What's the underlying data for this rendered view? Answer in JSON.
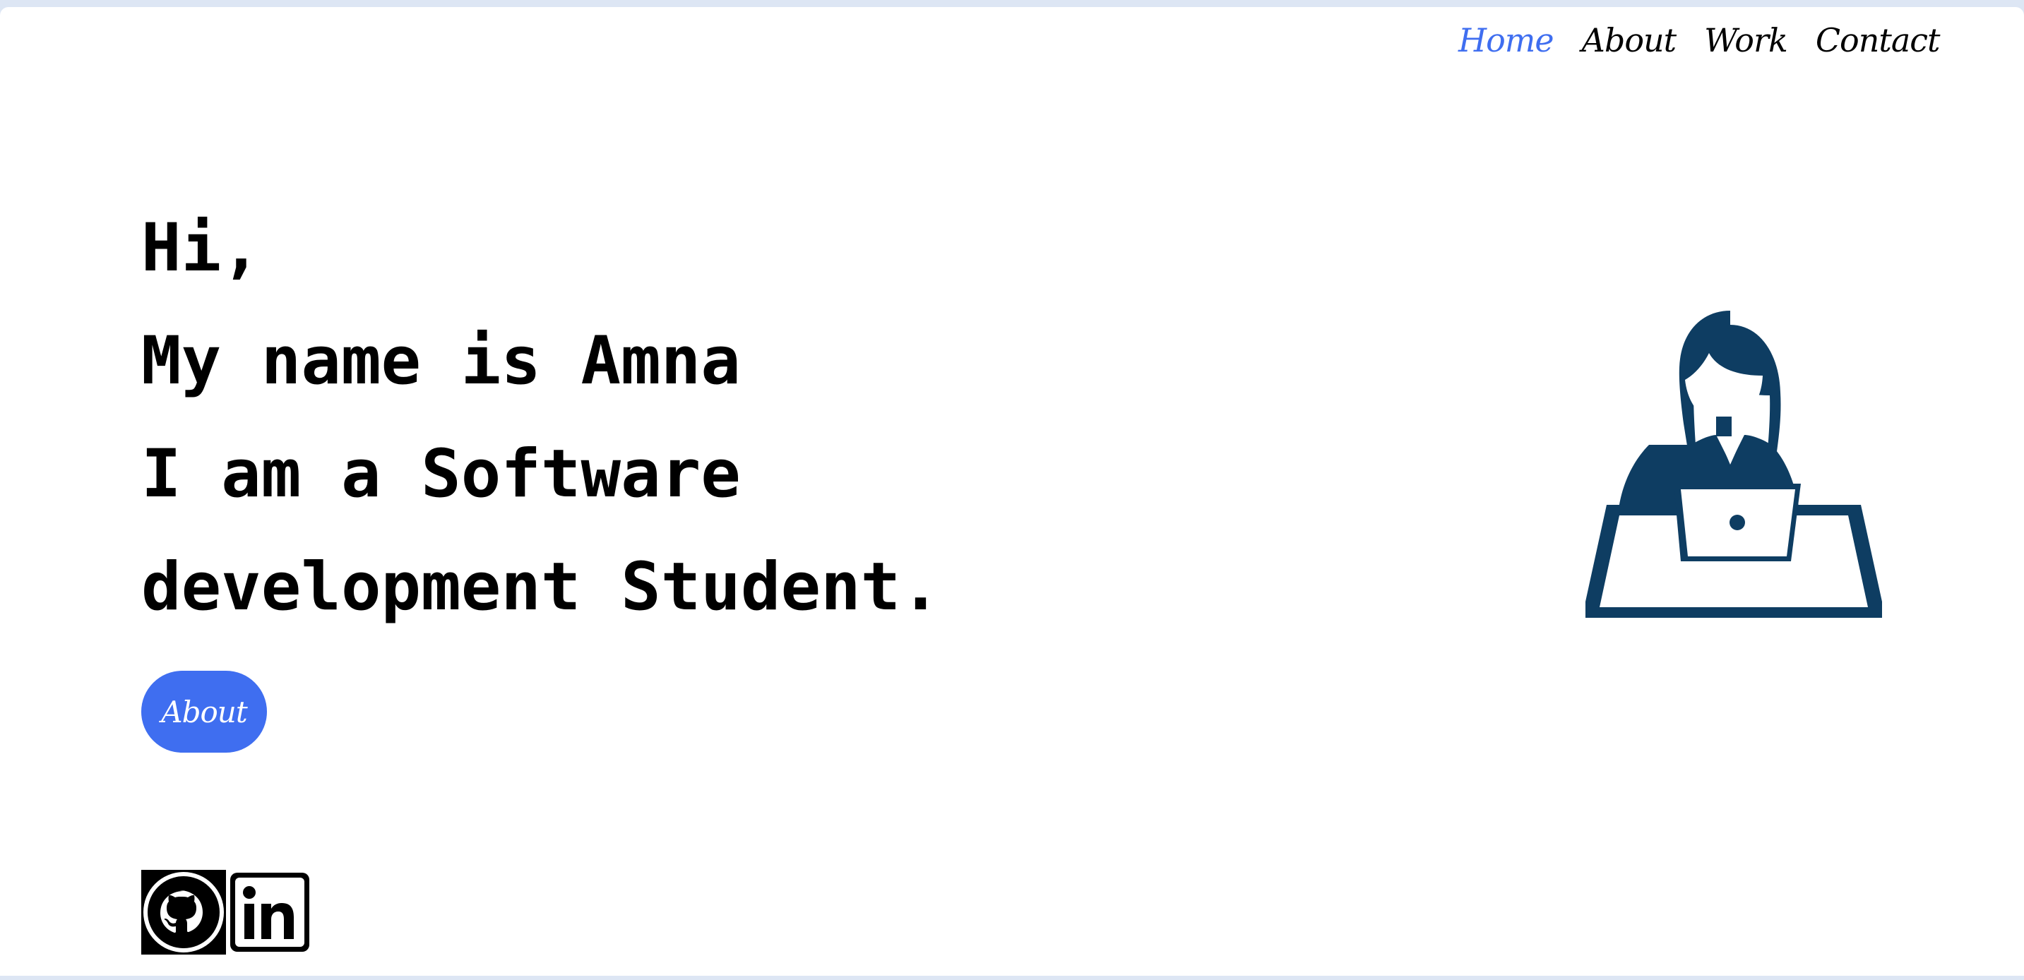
{
  "nav": {
    "items": [
      {
        "label": "Home",
        "active": true
      },
      {
        "label": "About",
        "active": false
      },
      {
        "label": "Work",
        "active": false
      },
      {
        "label": "Contact",
        "active": false
      }
    ]
  },
  "hero": {
    "lines": [
      "Hi,",
      "My name is Amna",
      "I am a Software",
      "development Student."
    ]
  },
  "cta": {
    "about_label": "About"
  },
  "social": {
    "icons": [
      "github-icon",
      "linkedin-icon"
    ]
  },
  "illustration": {
    "icon": "woman-at-laptop-icon"
  },
  "colors": {
    "accent": "#3f6ef0",
    "illustration": "#0e3d62",
    "text": "#000000",
    "background": "#ffffff",
    "frame": "#dde6f4"
  }
}
